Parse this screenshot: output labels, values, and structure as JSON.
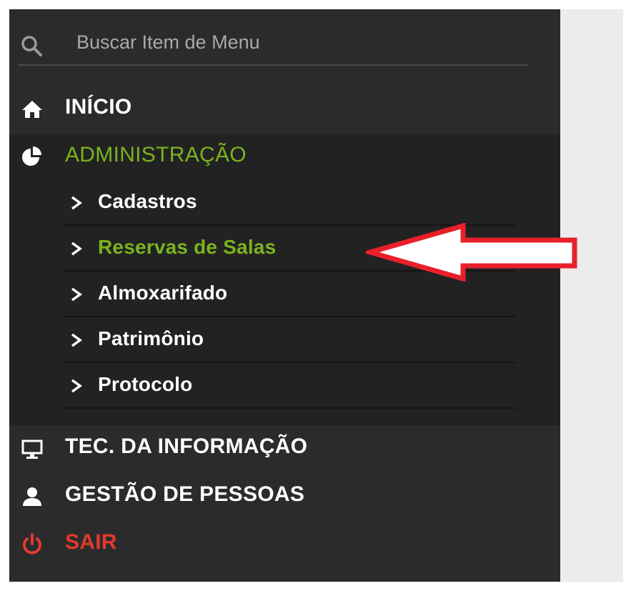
{
  "search": {
    "placeholder": "Buscar Item de Menu",
    "icon": "search-icon"
  },
  "menu": {
    "inicio": {
      "label": "INÍCIO",
      "icon": "home-icon"
    },
    "administracao": {
      "label": "ADMINISTRAÇÃO",
      "icon": "pie-chart-icon",
      "submenu": [
        {
          "label": "Cadastros"
        },
        {
          "label": "Reservas de Salas",
          "active": true
        },
        {
          "label": "Almoxarifado"
        },
        {
          "label": "Patrimônio"
        },
        {
          "label": "Protocolo"
        }
      ]
    },
    "tec_informacao": {
      "label": "TEC. DA INFORMAÇÃO",
      "icon": "monitor-icon"
    },
    "gestao_pessoas": {
      "label": "GESTÃO DE PESSOAS",
      "icon": "user-icon"
    },
    "sair": {
      "label": "SAIR",
      "icon": "power-icon"
    }
  },
  "colors": {
    "sidebar_bg": "#2b2b2b",
    "submenu_bg": "#222222",
    "accent_green": "#7bb31e",
    "danger_red": "#e03b2d",
    "annotation_arrow": "#e8202a"
  }
}
